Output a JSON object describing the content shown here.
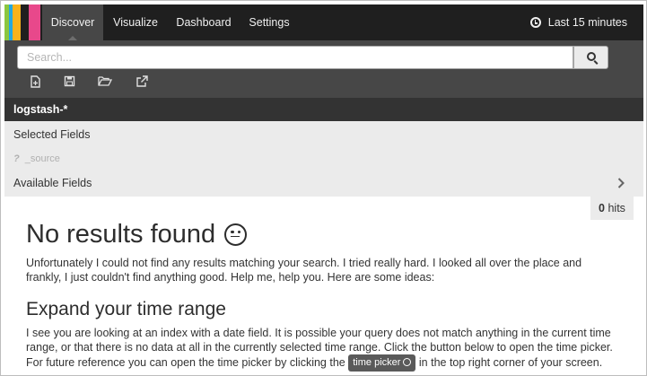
{
  "nav": {
    "logo_colors": [
      "#8cc63f",
      "#25a8e0",
      "#f9b21b",
      "#1f1f1f",
      "#e8488b"
    ],
    "tabs": [
      {
        "label": "Discover",
        "active": true
      },
      {
        "label": "Visualize",
        "active": false
      },
      {
        "label": "Dashboard",
        "active": false
      },
      {
        "label": "Settings",
        "active": false
      }
    ],
    "time_range": "Last 15 minutes"
  },
  "search": {
    "placeholder": "Search...",
    "value": ""
  },
  "toolbar": {
    "icons": [
      "new-search-icon",
      "save-icon",
      "open-icon",
      "share-icon"
    ]
  },
  "sidebar": {
    "index_pattern": "logstash-*",
    "selected_fields_label": "Selected Fields",
    "source_field_type": "?",
    "source_field_name": "_source",
    "available_fields_label": "Available Fields"
  },
  "hits": {
    "count": "0",
    "label": " hits"
  },
  "results": {
    "title": "No results found",
    "message": "Unfortunately I could not find any results matching your search. I tried really hard. I looked all over the place and frankly, I just couldn't find anything good. Help me, help you. Here are some ideas:",
    "expand_title": "Expand your time range",
    "expand_text_before": "I see you are looking at an index with a date field. It is possible your query does not match anything in the current time range, or that there is no data at all in the currently selected time range. Click the button below to open the time picker. For future reference you can open the time picker by clicking the",
    "time_picker_badge": "time picker",
    "expand_text_after": "in the top right corner of your screen."
  }
}
